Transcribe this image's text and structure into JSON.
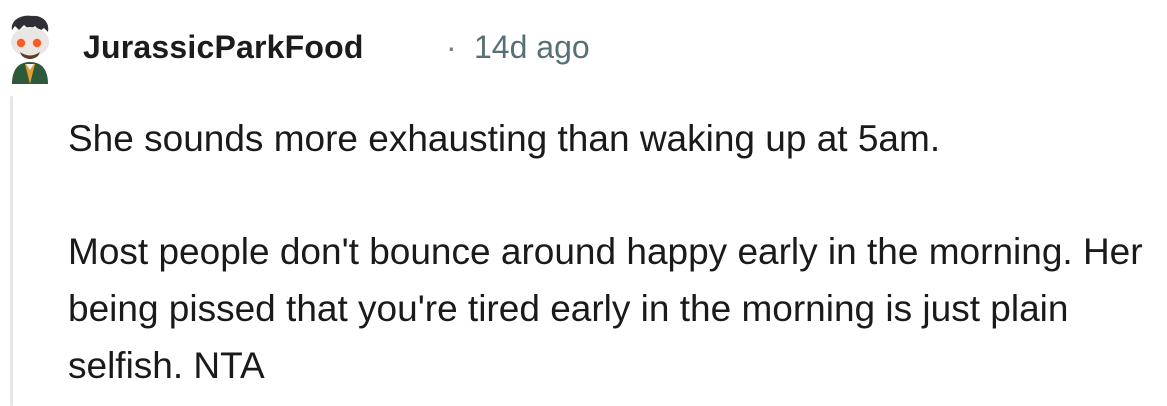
{
  "comment": {
    "username": "JurassicParkFood",
    "separator": "·",
    "timestamp": "14d ago",
    "paragraphs": [
      "She sounds more exhausting than waking up at 5am.",
      "Most people don't bounce around happy early in the morning. Her being pissed that you're tired early in the morning is just plain selfish. NTA"
    ]
  },
  "colors": {
    "username": "#1c1c1c",
    "timestamp": "#576f76",
    "thread_line": "#e5e7e8",
    "text": "#1a1a1b"
  },
  "avatar": {
    "icon": "snoo-avatar-icon"
  }
}
